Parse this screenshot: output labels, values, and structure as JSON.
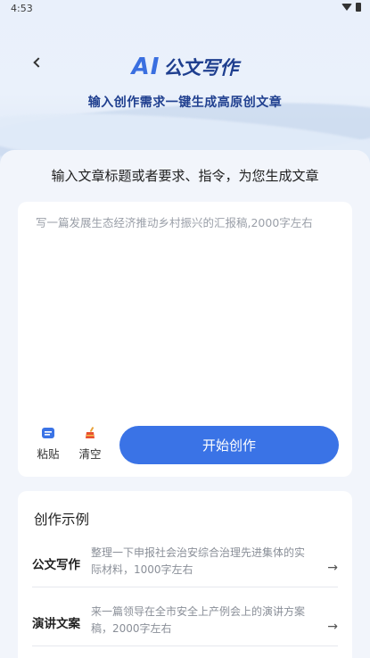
{
  "status_bar": {
    "time": "4:53"
  },
  "header": {
    "back_label": "‹",
    "title_ai": "AI",
    "title_main": "公文写作",
    "subtitle": "输入创作需求一键生成高原创文章"
  },
  "main": {
    "prompt": "输入文章标题或者要求、指令，为您生成文章",
    "editor_placeholder": "写一篇发展生态经济推动乡村振兴的汇报稿,2000字左右",
    "paste_label": "粘贴",
    "clear_label": "清空",
    "start_button": "开始创作"
  },
  "examples": {
    "title": "创作示例",
    "items": [
      {
        "label": "公文写作",
        "desc": "整理一下申报社会治安综合治理先进集体的实际材料，1000字左右"
      },
      {
        "label": "演讲文案",
        "desc": "来一篇领导在全市安全上产例会上的演讲方案稿，2000字左右"
      }
    ]
  },
  "colors": {
    "accent": "#3a73e6",
    "title_blue": "#1f3f8f",
    "background": "#f2f5fb"
  }
}
